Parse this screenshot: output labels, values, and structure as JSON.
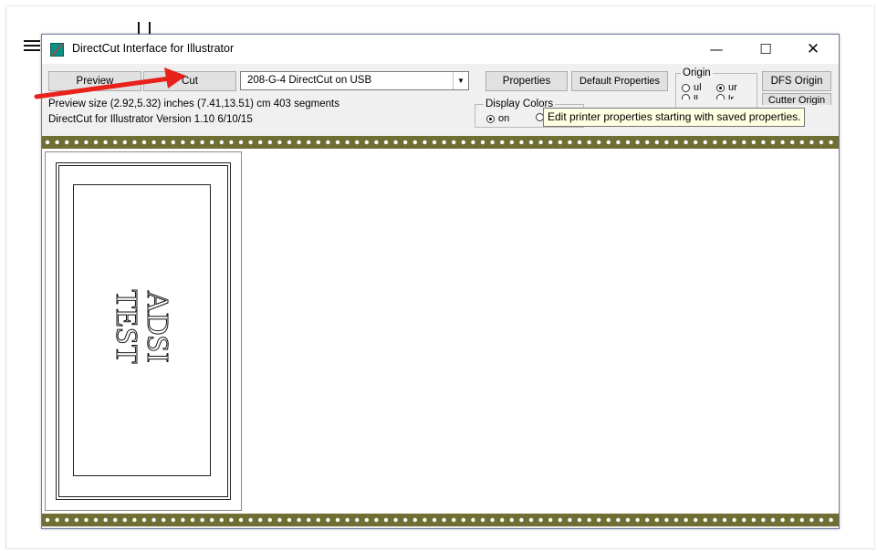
{
  "window": {
    "title": "DirectCut Interface for Illustrator",
    "controls": {
      "minimize": "—",
      "maximize": "☐",
      "close": "✕"
    }
  },
  "toolbar": {
    "preview_label": "Preview",
    "cut_label": "Cut",
    "device_selected": "208-G-4 DirectCut on USB",
    "properties_label": "Properties",
    "default_properties_label": "Default Properties",
    "dfs_origin_label": "DFS Origin",
    "cutter_origin_label": "Cutter Origin"
  },
  "info": {
    "preview_size": "Preview size (2.92,5.32) inches  (7.41,13.51) cm   403 segments",
    "version": "DirectCut for Illustrator Version 1.10 6/10/15"
  },
  "display_colors": {
    "label": "Display Colors",
    "on_label": "on",
    "off_label": "",
    "selected": "on"
  },
  "origin": {
    "label": "Origin",
    "options": [
      "ul",
      "ur",
      "ll",
      "lr"
    ],
    "option_labels": {
      "ul": "ul",
      "ur": "ur",
      "ll": "ll",
      "lr": "lr"
    },
    "selected": "ur"
  },
  "tooltip": {
    "text": "Edit printer properties starting with saved properties."
  },
  "preview": {
    "art_lines": [
      "ADSI",
      "TEST"
    ],
    "film_color": "#6f6f34",
    "hole_color": "#ffffff"
  },
  "annotation": {
    "arrow_color": "#e8211b",
    "points_to": "cut-button"
  }
}
